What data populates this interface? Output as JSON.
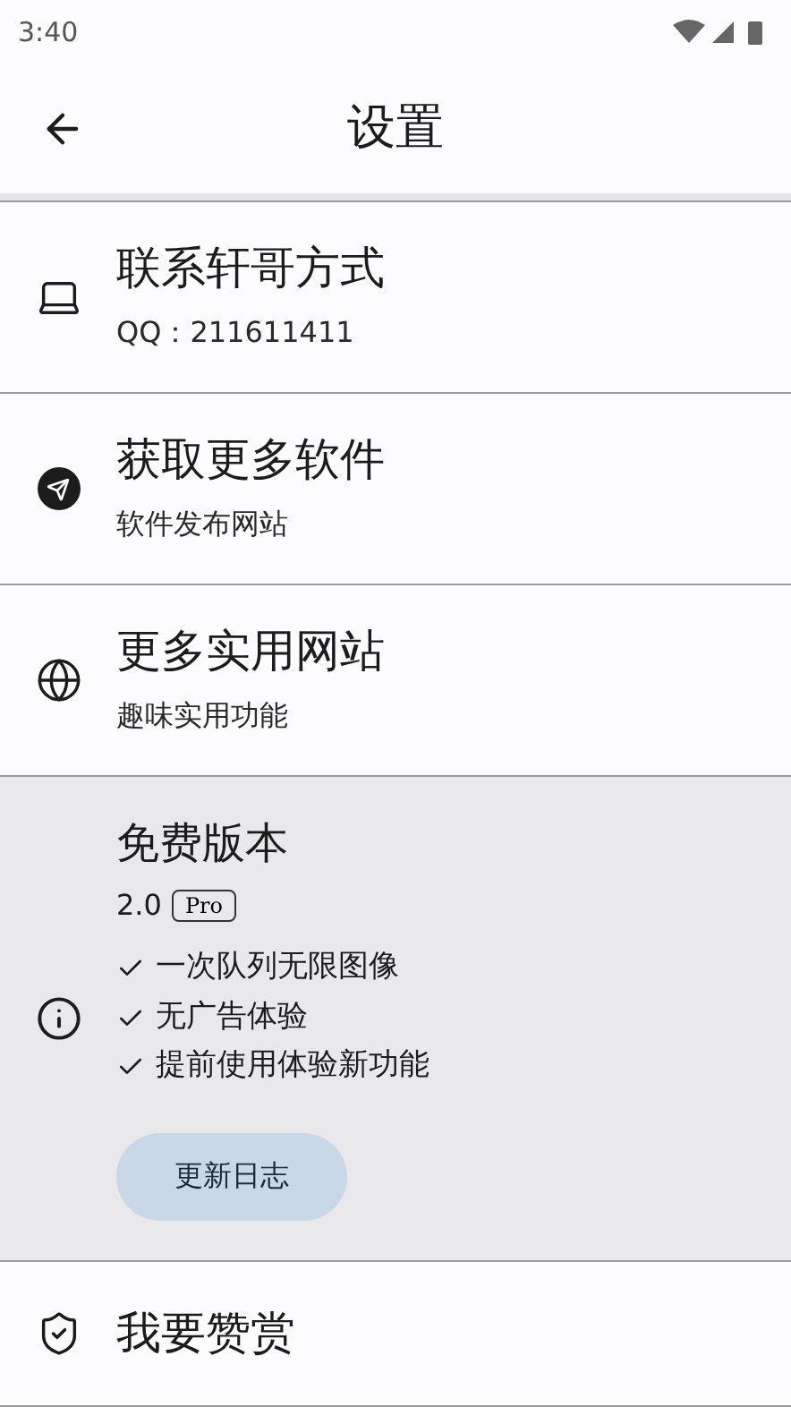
{
  "status_bar": {
    "time": "3:40"
  },
  "app_bar": {
    "title": "设置"
  },
  "items": [
    {
      "kind": "link",
      "title": "联系轩哥方式",
      "subtitle": "QQ：211611411"
    },
    {
      "kind": "link",
      "title": "获取更多软件",
      "subtitle": "软件发布网站"
    },
    {
      "kind": "link",
      "title": "更多实用网站",
      "subtitle": "趣味实用功能"
    },
    {
      "kind": "version",
      "title": "免费版本",
      "version": "2.0",
      "badge": "Pro",
      "features": [
        "一次队列无限图像",
        "无广告体验",
        "提前使用体验新功能"
      ],
      "button": "更新日志"
    },
    {
      "kind": "link",
      "title": "我要赞赏"
    }
  ]
}
